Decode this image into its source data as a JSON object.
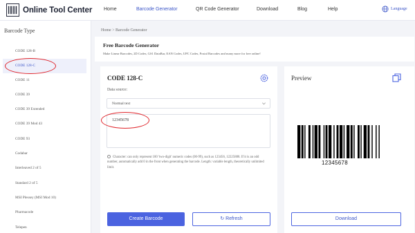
{
  "header": {
    "logo_text": "Online Tool Center",
    "nav": [
      "Home",
      "Barcode Generator",
      "QR Code Generator",
      "Download",
      "Blog",
      "Help"
    ],
    "active_nav": "Barcode Generator",
    "language": "Language"
  },
  "sidebar": {
    "title": "Barcode Type",
    "items": [
      "CODE 128-B",
      "CODE 128-C",
      "CODE 11",
      "CODE 39",
      "CODE 39 Extended",
      "CODE 39 Mod 43",
      "CODE 93",
      "Codabar",
      "Interleaved 2 of 5",
      "Standard 2 of 5",
      "MSI Plessey (MSI Mod 10)",
      "Pharmacode",
      "Telepen"
    ],
    "active_item": "CODE 128-C"
  },
  "breadcrumb": "Home > Barcode Generator",
  "banner": {
    "title": "Free Barcode Generator",
    "description": "Make Linear Barcodes, 2D Codes, GS1 DataBar, EAN Codes, UPC Codes, Postal Barcodes and many more for free online!"
  },
  "generator": {
    "title": "CODE 128-C",
    "data_source_label": "Data source:",
    "data_source_value": "Normal text",
    "input_value": "12345678",
    "info_text": "Character: can only represent 100 'two-digit' numeric codes (00-99), such as 123456, 12225888. If it is an odd number, automatically add 0 in the front when generating the barcode. Length: variable length, theoretically unlimited limit.",
    "create_button": "Create Barcode",
    "refresh_button": "Refresh"
  },
  "preview": {
    "title": "Preview",
    "barcode_text": "12345678",
    "download_button": "Download"
  },
  "colors": {
    "accent": "#4b63e0",
    "annotation": "#e0242a"
  }
}
